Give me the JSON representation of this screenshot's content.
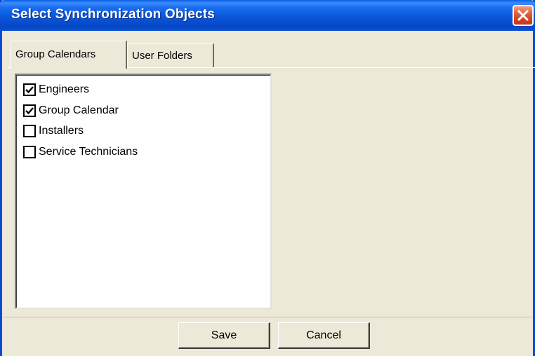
{
  "window": {
    "title": "Select Synchronization Objects"
  },
  "tabs": [
    {
      "label": "Group Calendars",
      "active": true
    },
    {
      "label": "User Folders",
      "active": false
    }
  ],
  "list": {
    "items": [
      {
        "label": "Engineers",
        "checked": true
      },
      {
        "label": "Group Calendar",
        "checked": true
      },
      {
        "label": "Installers",
        "checked": false
      },
      {
        "label": "Service Technicians",
        "checked": false
      }
    ]
  },
  "buttons": {
    "save_label": "Save",
    "cancel_label": "Cancel"
  },
  "icons": {
    "close": "close-icon",
    "check": "check-icon"
  },
  "colors": {
    "titlebar": "#0a55d8",
    "close": "#d24422",
    "face": "#ece9d8"
  }
}
